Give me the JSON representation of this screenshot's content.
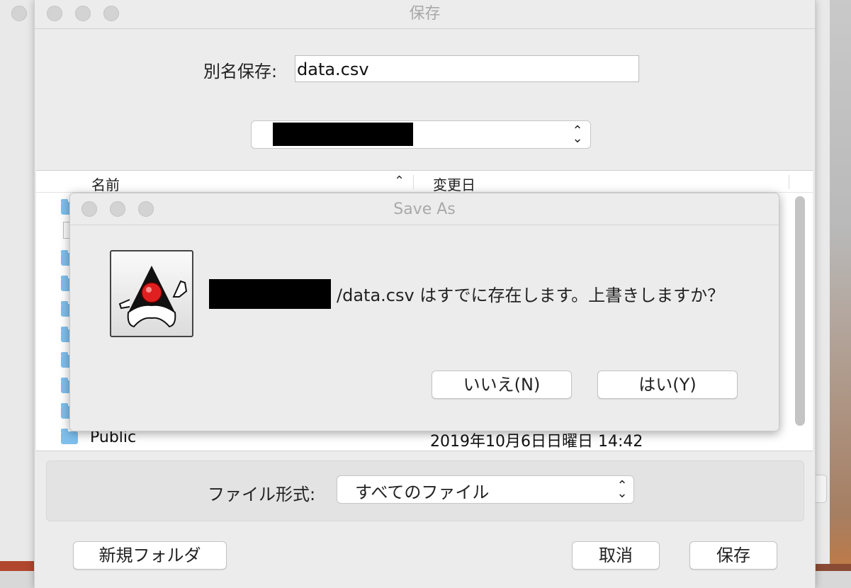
{
  "save_panel": {
    "title": "保存",
    "save_as_label": "別名保存:",
    "filename": "data.csv",
    "columns": {
      "name": "名前",
      "modified": "変更日"
    },
    "rows": [
      {
        "name": "Public",
        "modified": "2019年10月6日日曜日 14:42"
      }
    ],
    "file_format_label": "ファイル形式:",
    "file_format_value": "すべてのファイル",
    "buttons": {
      "new_folder": "新規フォルダ",
      "cancel": "取消",
      "save": "保存"
    }
  },
  "confirm_dialog": {
    "title": "Save As",
    "message": "/data.csv はすでに存在します。上書きしますか？",
    "buttons": {
      "no": "いいえ(N)",
      "yes": "はい(Y)"
    }
  },
  "icons": {
    "traffic_lights": "window-control-dots",
    "sort": "chevron-up-icon",
    "stepper": "up-down-chevron-icon",
    "app": "java-duke-icon"
  }
}
